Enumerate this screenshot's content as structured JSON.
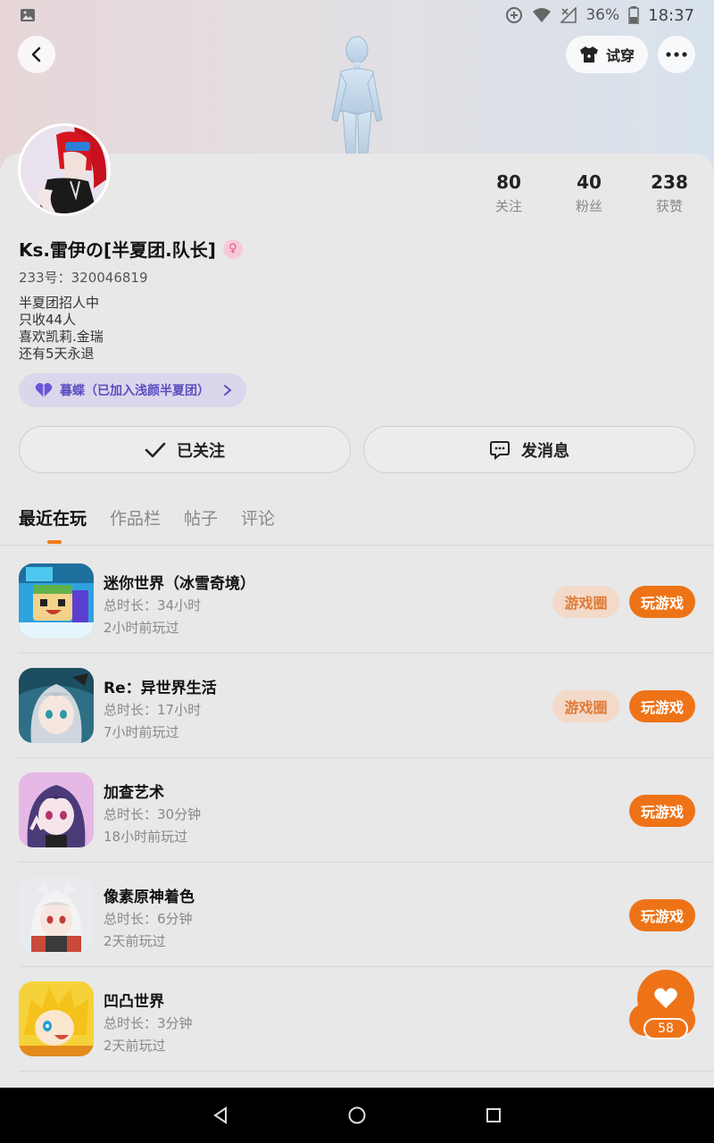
{
  "status_bar": {
    "battery": "36%",
    "time": "18:37"
  },
  "header": {
    "try_on_label": "试穿"
  },
  "profile": {
    "name": "Ks.雷伊の[半夏团.队长]",
    "gender_symbol": "♀",
    "uid": "233号：320046819",
    "bio": [
      "半夏团招人中",
      "只收44人",
      "喜欢凯莉.金瑞",
      "还有5天永退"
    ],
    "guild_label": "暮蝶（已加入浅颜半夏团）",
    "stats": [
      {
        "value": "80",
        "label": "关注"
      },
      {
        "value": "40",
        "label": "粉丝"
      },
      {
        "value": "238",
        "label": "获赞"
      }
    ]
  },
  "actions": {
    "follow_label": "已关注",
    "message_label": "发消息"
  },
  "tabs": [
    "最近在玩",
    "作品栏",
    "帖子",
    "评论"
  ],
  "games": [
    {
      "name": "迷你世界（冰雪奇境）",
      "duration": "总时长：34小时",
      "last_played": "2小时前玩过",
      "circle_label": "游戏圈",
      "play_label": "玩游戏"
    },
    {
      "name": "Re：异世界生活",
      "duration": "总时长：17小时",
      "last_played": "7小时前玩过",
      "circle_label": "游戏圈",
      "play_label": "玩游戏"
    },
    {
      "name": "加查艺术",
      "duration": "总时长：30分钟",
      "last_played": "18小时前玩过",
      "play_label": "玩游戏"
    },
    {
      "name": "像素原神着色",
      "duration": "总时长：6分钟",
      "last_played": "2天前玩过",
      "play_label": "玩游戏"
    },
    {
      "name": "凹凸世界",
      "duration": "总时长：3分钟",
      "last_played": "2天前玩过",
      "play_label": ""
    }
  ],
  "fab": {
    "count": "58"
  },
  "colors": {
    "accent": "#ee7317",
    "guild_text": "#5a4fc0",
    "guild_bg": "#dcd6ec"
  }
}
